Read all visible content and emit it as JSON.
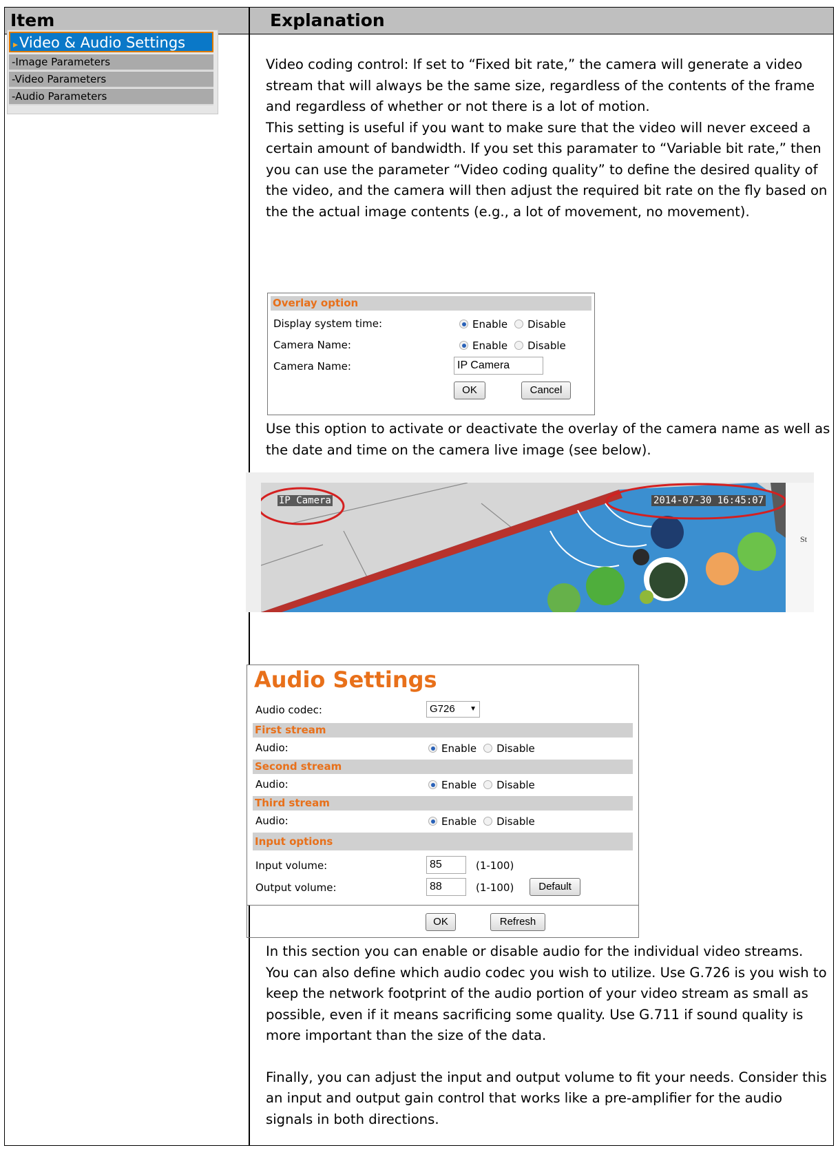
{
  "header": {
    "item": "Item",
    "explanation": "Explanation"
  },
  "nav": {
    "active": "Video & Audio Settings",
    "items": [
      "-Image Parameters",
      "-Video Parameters",
      "-Audio Parameters"
    ]
  },
  "paragraphs": {
    "p1": "Video coding control: If set to “Fixed bit rate,” the camera will generate a video stream that will always be the same size, regardless of the contents of the frame and regardless of whether or not there is a lot of motion.",
    "p2": "This setting is useful if you want to make sure that the video will never exceed a certain amount of bandwidth. If you set this paramater to “Variable bit rate,” then you can use the parameter “Video coding quality” to define the desired quality of the video, and the camera will then adjust the required bit rate on the fly based on the the actual image contents (e.g., a lot of movement, no movement).",
    "p3": "Use this option to activate or deactivate the overlay of the camera name as well as the date and time on the camera live image (see below).",
    "p4": "In this section you can enable or disable audio for the individual video streams. You can also define which audio codec you wish to utilize. Use G.726 is you wish to keep the network footprint of the audio portion of your video stream as small as possible, even if it means sacrificing some quality. Use G.711 if sound quality is more important than the size of the data.",
    "p5": "Finally, you can adjust the input and output volume to fit your needs. Consider this an input and output gain control that works like a pre-amplifier for the audio signals in both directions."
  },
  "overlay": {
    "section": "Overlay option",
    "row1_label": "Display system time:",
    "row2_label": "Camera Name:",
    "row3_label": "Camera Name:",
    "enable": "Enable",
    "disable": "Disable",
    "name_value": "IP Camera",
    "ok": "OK",
    "cancel": "Cancel"
  },
  "camera": {
    "name_overlay": "IP Camera",
    "time_overlay": "2014-07-30 16:45:07",
    "side_text": "St"
  },
  "audio": {
    "title": "Audio Settings",
    "codec_label": "Audio codec:",
    "codec_value": "G726",
    "first_stream": "First stream",
    "second_stream": "Second stream",
    "third_stream": "Third stream",
    "audio_label": "Audio:",
    "enable": "Enable",
    "disable": "Disable",
    "input_options": "Input options",
    "input_volume_label": "Input volume:",
    "input_volume_value": "85",
    "output_volume_label": "Output volume:",
    "output_volume_value": "88",
    "range": "(1-100)",
    "default": "Default",
    "ok": "OK",
    "refresh": "Refresh"
  }
}
